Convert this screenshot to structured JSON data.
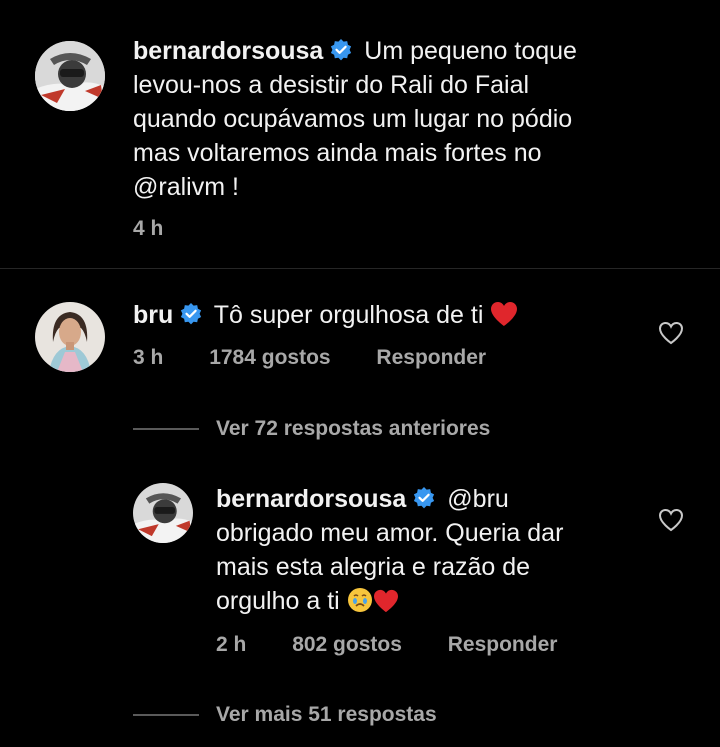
{
  "caption": {
    "username": "bernardorsousa",
    "lines": [
      "Um pequeno toque",
      "levou-nos a desistir do Rali do Faial",
      "quando ocupávamos um lugar no pódio",
      "mas voltaremos ainda mais fortes no",
      "@ralivm !"
    ],
    "time": "4 h"
  },
  "comment": {
    "username": "bru",
    "text": "Tô super orgulhosa de ti",
    "time": "3 h",
    "likes": "1784 gostos",
    "reply_label": "Responder"
  },
  "view_previous": "Ver 72 respostas anteriores",
  "reply": {
    "username": "bernardorsousa",
    "lines": [
      "@bru",
      "obrigado meu amor. Queria dar",
      "mais esta alegria e razão de",
      "orgulho a ti"
    ],
    "time": "2 h",
    "likes": "802 gostos",
    "reply_label": "Responder"
  },
  "view_more": "Ver mais 51 respostas",
  "colors": {
    "verified": "#3897f0",
    "heart": "#ed4956",
    "meta": "#a8a8a8",
    "background": "#000000"
  },
  "icons": [
    "verified-badge-icon",
    "heart-emoji-icon",
    "like-heart-icon",
    "crying-face-emoji-icon"
  ]
}
